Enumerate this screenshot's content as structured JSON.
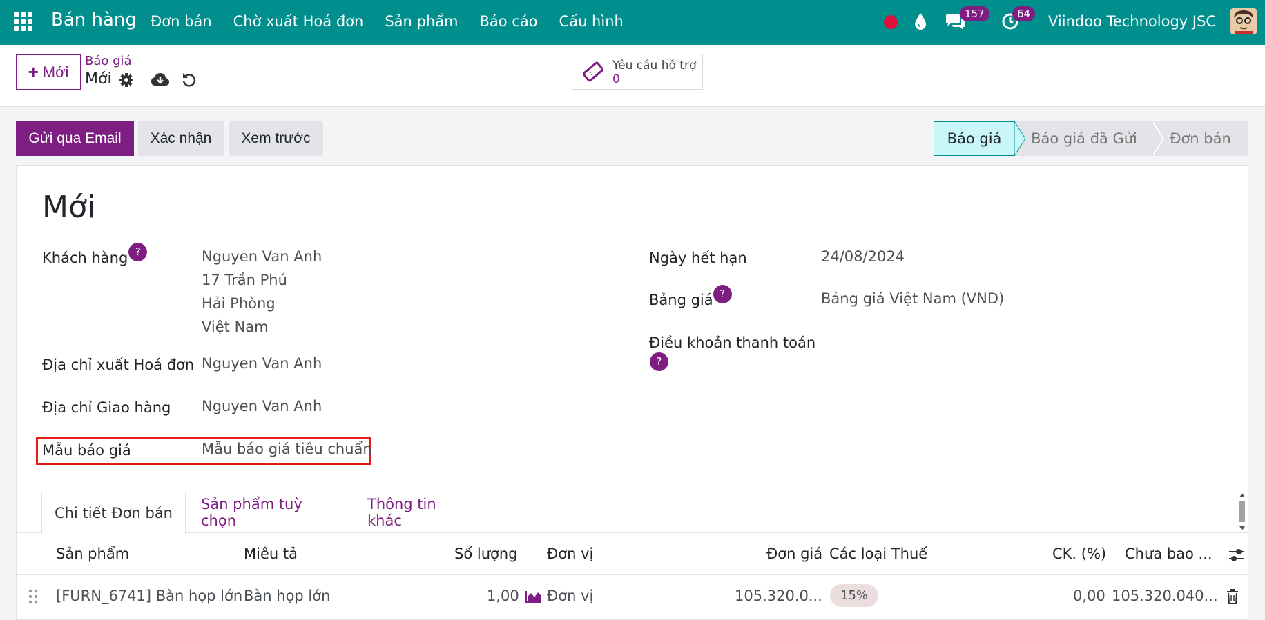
{
  "navbar": {
    "app_title": "Bán hàng",
    "menu": [
      "Đơn bán",
      "Chờ xuất Hoá đơn",
      "Sản phẩm",
      "Báo cáo",
      "Cấu hình"
    ],
    "messages_count": "157",
    "activities_count": "64",
    "company": "Viindoo Technology JSC"
  },
  "control": {
    "new_label": "Mới",
    "breadcrumb_parent": "Báo giá",
    "breadcrumb_current": "Mới",
    "support_label": "Yêu cầu hỗ trợ",
    "support_count": "0"
  },
  "actions": {
    "send_email": "Gửi qua Email",
    "confirm": "Xác nhận",
    "preview": "Xem trước"
  },
  "stages": [
    "Báo giá",
    "Báo giá đã Gửi",
    "Đơn bán"
  ],
  "form": {
    "title": "Mới",
    "customer_label": "Khách hàng",
    "customer_lines": [
      "Nguyen Van Anh",
      "17 Trần Phú",
      "Hải Phòng",
      "Việt Nam"
    ],
    "invoice_address_label": "Địa chỉ xuất Hoá đơn",
    "invoice_address": "Nguyen Van Anh",
    "delivery_address_label": "Địa chỉ Giao hàng",
    "delivery_address": "Nguyen Van Anh",
    "template_label": "Mẫu báo giá",
    "template": "Mẫu báo giá tiêu chuẩn",
    "expiry_label": "Ngày hết hạn",
    "expiry": "24/08/2024",
    "pricelist_label": "Bảng giá",
    "pricelist": "Bảng giá Việt Nam (VND)",
    "payment_terms_label": "Điều khoản thanh toán",
    "help": "?"
  },
  "tabs": [
    "Chi tiết Đơn bán",
    "Sản phẩm tuỳ chọn",
    "Thông tin khác"
  ],
  "table": {
    "headers": [
      "Sản phẩm",
      "Miêu tả",
      "Số lượng",
      "Đơn vị",
      "Đơn giá",
      "Các loại Thuế",
      "CK. (%)",
      "Chưa bao ..."
    ],
    "rows": [
      {
        "product": "[FURN_6741] Bàn họp lớn",
        "description": "Bàn họp lớn",
        "quantity": "1,00",
        "uom": "Đơn vị",
        "unit_price": "105.320.0...",
        "tax": "15%",
        "discount": "0,00",
        "subtotal": "105.320.040..."
      }
    ]
  },
  "colors": {
    "navbar": "#008f8c",
    "primary": "#7e1e83",
    "highlight": "#e31b1b"
  }
}
